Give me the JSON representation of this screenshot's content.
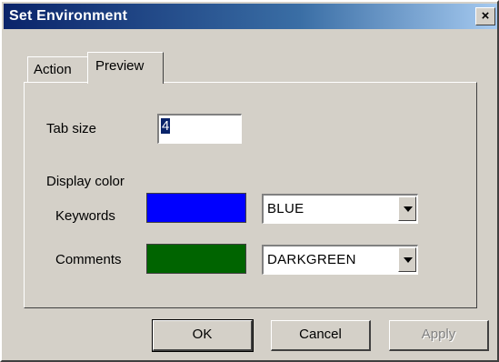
{
  "window": {
    "title": "Set Environment",
    "close_glyph": "×"
  },
  "tabs": [
    {
      "label": "Action",
      "active": false
    },
    {
      "label": "Preview",
      "active": true
    }
  ],
  "preview": {
    "tab_size_label": "Tab size",
    "tab_size_value": "4",
    "display_color_label": "Display color",
    "keywords": {
      "label": "Keywords",
      "swatch_color": "#0000ff",
      "selected": "BLUE"
    },
    "comments": {
      "label": "Comments",
      "swatch_color": "#006400",
      "selected": "DARKGREEN"
    }
  },
  "buttons": {
    "ok": "OK",
    "cancel": "Cancel",
    "apply": "Apply",
    "apply_enabled": false
  },
  "colors": {
    "dialog_face": "#d4d0c8",
    "titlebar_start": "#0a246a",
    "titlebar_end": "#a6caf0"
  }
}
